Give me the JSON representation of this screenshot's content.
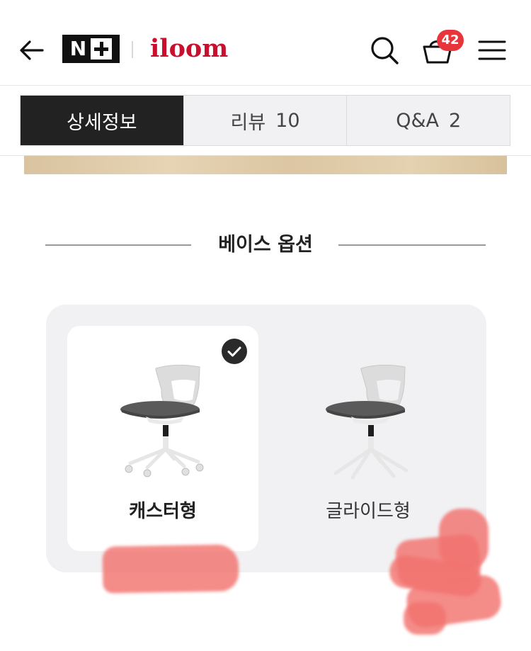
{
  "header": {
    "partner_logo_letter": "N",
    "brand_name": "iloom",
    "cart_count": "42"
  },
  "tabs": [
    {
      "label": "상세정보",
      "count": ""
    },
    {
      "label": "리뷰",
      "count": "10"
    },
    {
      "label": "Q&A",
      "count": "2"
    }
  ],
  "section": {
    "title": "베이스 옵션"
  },
  "options": [
    {
      "label": "캐스터형",
      "selected": true
    },
    {
      "label": "글라이드형",
      "selected": false
    }
  ],
  "colors": {
    "brand": "#c8102e",
    "badge": "#e8353b",
    "active_tab": "#222222",
    "panel": "#f1f1f3",
    "marker": "#f2736f"
  },
  "icons": [
    "back-arrow-icon",
    "search-icon",
    "shopping-basket-icon",
    "hamburger-menu-icon",
    "check-icon"
  ]
}
